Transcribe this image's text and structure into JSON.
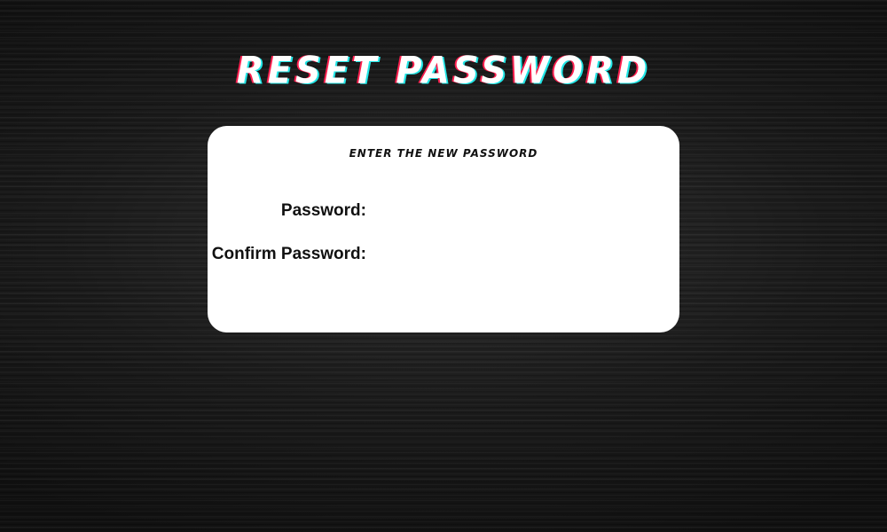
{
  "page": {
    "title": "Reset Password"
  },
  "card": {
    "heading": "Enter the new password",
    "fields": [
      {
        "label": "Password:",
        "value": "",
        "placeholder": ""
      },
      {
        "label": "Confirm Password:",
        "value": "",
        "placeholder": ""
      }
    ]
  },
  "colors": {
    "background": "#1b1b1b",
    "card": "#ffffff",
    "title_text": "#ffffff",
    "title_shadow_red": "#ff1f4f",
    "title_shadow_cyan": "#21e6e6"
  }
}
